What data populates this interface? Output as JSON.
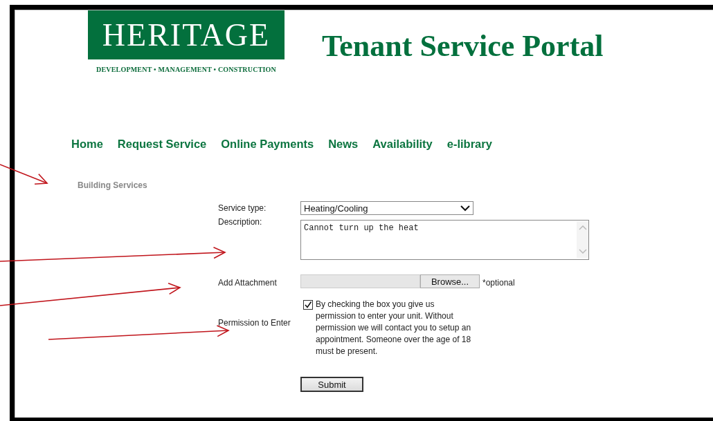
{
  "logo": {
    "name": "HERITAGE",
    "tagline": "DEVELOPMENT • MANAGEMENT • CONSTRUCTION"
  },
  "title": "Tenant Service Portal",
  "nav": [
    "Home",
    "Request Service",
    "Online Payments",
    "News",
    "Availability",
    "e-library"
  ],
  "section_title": "Building Services",
  "form": {
    "service_type": {
      "label": "Service type:",
      "value": "Heating/Cooling"
    },
    "description": {
      "label": "Description:",
      "value": "Cannot turn up the heat"
    },
    "attachment": {
      "label": "Add Attachment",
      "button": "Browse...",
      "note": "*optional"
    },
    "permission": {
      "label": "Permission to Enter",
      "checked": true,
      "text": "By checking the box you give us permission to enter your unit. Without permission we will contact you to setup an appointment. Someone over the age of 18 must be present."
    },
    "submit": "Submit"
  }
}
